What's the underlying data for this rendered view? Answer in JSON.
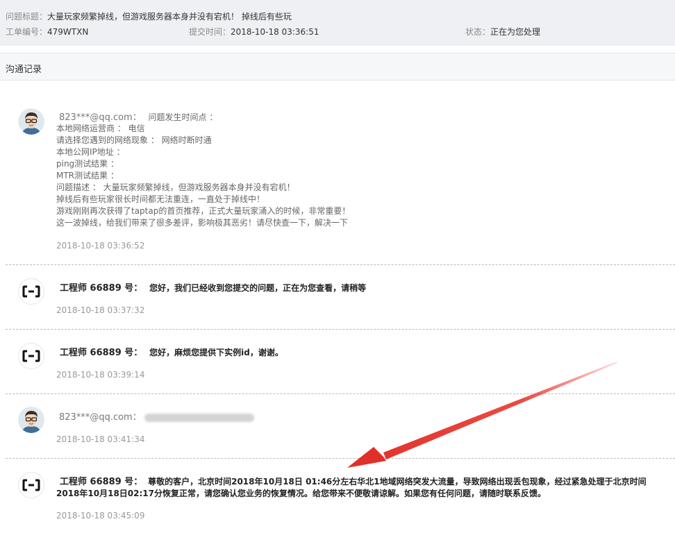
{
  "ticket": {
    "title_label": "问题标题：",
    "title_value": "大量玩家频繁掉线，但游戏服务器本身并没有宕机！ 掉线后有些玩",
    "id_label": "工单编号：",
    "id_value": "479WTXN",
    "submit_label": "提交时间：",
    "submit_value": "2018-10-18 03:36:51",
    "status_label": "状态：",
    "status_value": "正在为您处理"
  },
  "section": {
    "title": "沟通记录"
  },
  "messages": [
    {
      "sender": "823***@qq.com：",
      "lines": [
        "问题发生时间点 ：",
        "本地网络运营商 ： 电信",
        "请选择您遇到的网络现象 ： 网络时断时通",
        "本地公网IP地址 ：",
        "ping测试结果 ：",
        "MTR测试结果 ：",
        "问题描述 ： 大量玩家频繁掉线，但游戏服务器本身并没有宕机！",
        "掉线后有些玩家很长时间都无法重连，一直处于掉线中！",
        "游戏刚刚再次获得了taptap的首页推荐，正式大量玩家涌入的时候，非常重要！",
        "这一波掉线，给我们带来了很多差评，影响极其恶劣！请尽快查一下，解决一下"
      ],
      "time": "2018-10-18 03:36:52"
    },
    {
      "sender": "工程师 66889 号：",
      "text": "您好，我们已经收到您提交的问题，正在为您查看，请稍等",
      "time": "2018-10-18 03:37:32"
    },
    {
      "sender": "工程师 66889 号：",
      "text": "您好，麻烦您提供下实例id，谢谢。",
      "time": "2018-10-18 03:39:14"
    },
    {
      "sender": "823***@qq.com：",
      "time": "2018-10-18 03:41:34"
    },
    {
      "sender": "工程师 66889 号：",
      "text1": "尊敬的客户，北京时间2018年10月18日 01:46分左右华北1地域网络突发大流量，导致网络出现丢包现象，经过紧急处理于北京时间",
      "text2": "2018年10月18日02:17分恢复正常，请您确认您业务的恢复情况。给您带来不便敬请谅解。如果您有任何问题，请随时联系反馈。",
      "time": "2018-10-18 03:45:09"
    }
  ],
  "colors": {
    "arrow": "#e8372f",
    "header_bg": "#eef0f3"
  },
  "icons": [
    "user-avatar-icon",
    "engineer-logo-icon",
    "annotation-arrow"
  ]
}
